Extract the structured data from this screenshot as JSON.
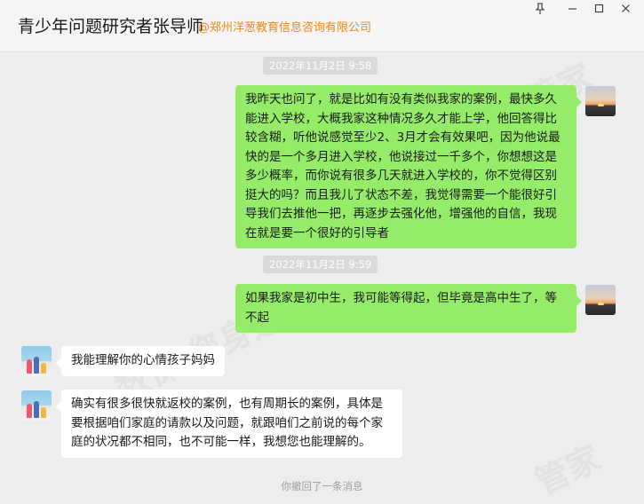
{
  "header": {
    "contact_name": "青少年问题研究者张导师",
    "company": "@郑州洋葱教育信息咨询有限公司"
  },
  "window_controls": {
    "pin_icon": "pin-icon",
    "minimize_icon": "minimize-icon",
    "maximize_icon": "maximize-icon",
    "close_icon": "close-icon"
  },
  "timestamps": [
    "2022年11月2日 9:58",
    "2022年11月2日 9:59"
  ],
  "messages": [
    {
      "side": "out",
      "text": "我昨天也问了，就是比如有没有类似我家的案例，最快多久能进入学校，大概我家这种情况多久才能上学，他回答得比较含糊，听他说感觉至少2、3月才会有效果吧，因为他说最快的是一个多月进入学校，他说接过一千多个，你想想这是多少概率，而你说有很多几天就进入学校的，你不觉得区别挺大的吗？而且我儿了状态不差，我觉得需要一个能很好引导我们去推他一把，再逐步去强化他，增强他的自信，我现在就是要一个很好的引导者"
    },
    {
      "side": "out",
      "text": "如果我家是初中生，我可能等得起，但毕竟是高中生了，等不起"
    },
    {
      "side": "in",
      "text": "我能理解你的心情孩子妈妈"
    },
    {
      "side": "in",
      "text": "确实有很多很快就返校的案例，也有周期长的案例，具体是要根据咱们家庭的请款以及问题，就跟咱们之前说的每个家庭的状况都不相同，也不可能一样，我想您也能理解的。"
    }
  ],
  "system_notice": "你撤回了一条消息",
  "colors": {
    "outgoing_bubble": "#95ec69",
    "incoming_bubble": "#ffffff",
    "chat_background": "#ededed",
    "company_text": "#ec8a1c"
  }
}
